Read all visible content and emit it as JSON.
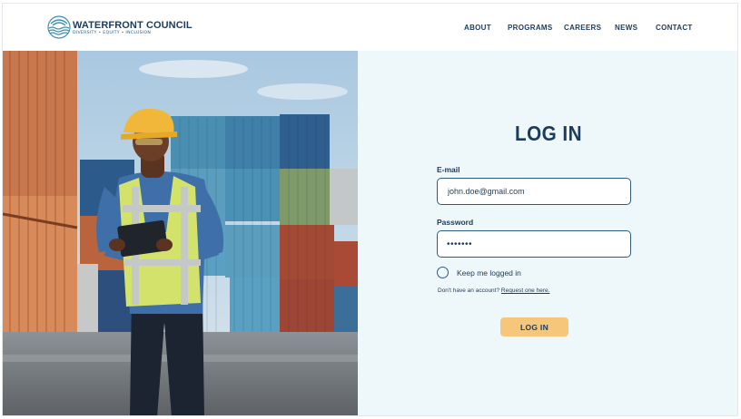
{
  "brand": {
    "title": "WATERFRONT COUNCIL",
    "subtitle": "DIVERSITY • EQUITY • INCLUSION",
    "logo_icon": "wave-circle-logo-icon",
    "primary_color": "#1d3b5c",
    "accent_color": "#f6c77a",
    "panel_color": "#eef7f9"
  },
  "nav": {
    "items": [
      {
        "label": "ABOUT"
      },
      {
        "label": "PROGRAMS"
      },
      {
        "label": "CAREERS"
      },
      {
        "label": "NEWS"
      },
      {
        "label": "CONTACT"
      }
    ]
  },
  "login": {
    "title": "LOG IN",
    "email_label": "E-mail",
    "email_value": "john.doe@gmail.com",
    "password_label": "Password",
    "password_masked": "•••••••",
    "remember_label": "Keep me logged in",
    "remember_checked": false,
    "account_prompt": "Don't have an account?",
    "account_link": "Request one here.",
    "submit_label": "LOG IN"
  },
  "hero_image": {
    "subject": "worker-in-hard-hat-with-tablet-at-container-yard"
  }
}
